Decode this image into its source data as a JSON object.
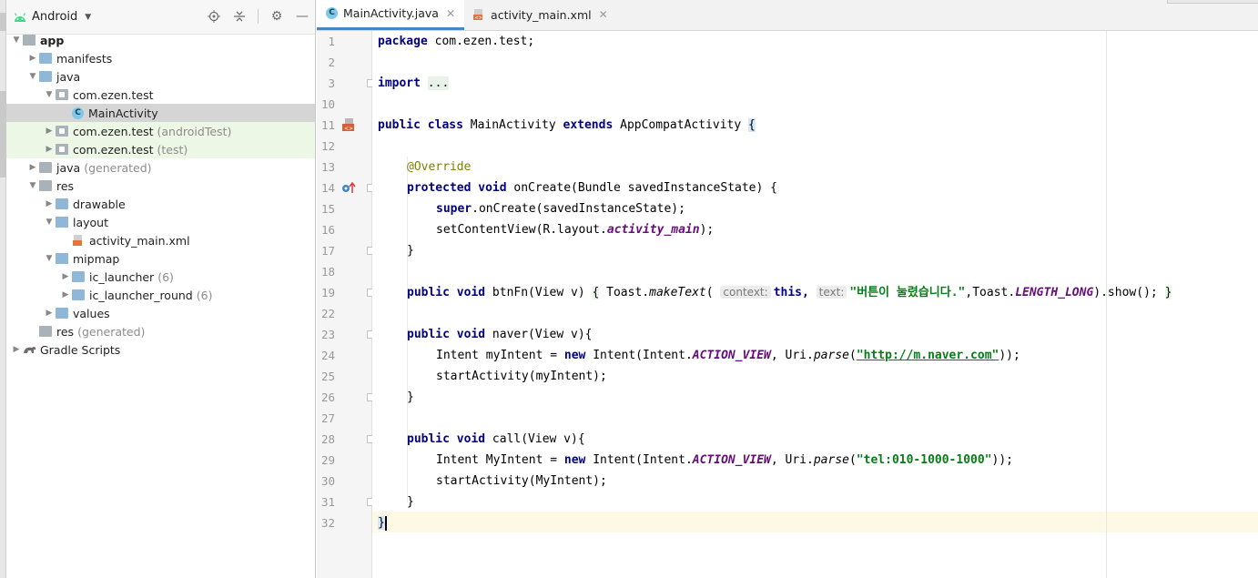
{
  "project_panel": {
    "view_mode": "Android",
    "tree": [
      {
        "label": "app",
        "depth": 0,
        "expanded": true,
        "icon": "module-icon",
        "bold": true
      },
      {
        "label": "manifests",
        "depth": 1,
        "expanded": false,
        "icon": "folder-icon"
      },
      {
        "label": "java",
        "depth": 1,
        "expanded": true,
        "icon": "folder-icon"
      },
      {
        "label": "com.ezen.test",
        "depth": 2,
        "expanded": true,
        "icon": "package-icon"
      },
      {
        "label": "MainActivity",
        "depth": 3,
        "icon": "java-class-icon",
        "selected": true
      },
      {
        "label": "com.ezen.test",
        "suffix": "(androidTest)",
        "depth": 2,
        "expanded": false,
        "icon": "package-icon",
        "test": true
      },
      {
        "label": "com.ezen.test",
        "suffix": "(test)",
        "depth": 2,
        "expanded": false,
        "icon": "package-icon",
        "test": true
      },
      {
        "label": "java",
        "suffix": "(generated)",
        "depth": 1,
        "expanded": false,
        "icon": "generated-folder-icon"
      },
      {
        "label": "res",
        "depth": 1,
        "expanded": true,
        "icon": "res-folder-icon"
      },
      {
        "label": "drawable",
        "depth": 2,
        "expanded": false,
        "icon": "folder-icon"
      },
      {
        "label": "layout",
        "depth": 2,
        "expanded": true,
        "icon": "folder-icon"
      },
      {
        "label": "activity_main.xml",
        "depth": 3,
        "icon": "xml-file-icon"
      },
      {
        "label": "mipmap",
        "depth": 2,
        "expanded": true,
        "icon": "folder-icon"
      },
      {
        "label": "ic_launcher",
        "suffix": "(6)",
        "depth": 3,
        "expanded": false,
        "icon": "folder-icon"
      },
      {
        "label": "ic_launcher_round",
        "suffix": "(6)",
        "depth": 3,
        "expanded": false,
        "icon": "folder-icon"
      },
      {
        "label": "values",
        "depth": 2,
        "expanded": false,
        "icon": "folder-icon"
      },
      {
        "label": "res",
        "suffix": "(generated)",
        "depth": 1,
        "icon": "res-folder-icon"
      },
      {
        "label": "Gradle Scripts",
        "depth": 0,
        "expanded": false,
        "icon": "gradle-icon"
      }
    ]
  },
  "tabs": [
    {
      "label": "MainActivity.java",
      "icon": "java-class-icon",
      "active": true
    },
    {
      "label": "activity_main.xml",
      "icon": "xml-file-icon",
      "active": false
    }
  ],
  "editor": {
    "current_line": "32",
    "lines": [
      {
        "n": "1"
      },
      {
        "n": "2"
      },
      {
        "n": "3"
      },
      {
        "n": "10"
      },
      {
        "n": "11"
      },
      {
        "n": "12"
      },
      {
        "n": "13"
      },
      {
        "n": "14"
      },
      {
        "n": "15"
      },
      {
        "n": "16"
      },
      {
        "n": "17"
      },
      {
        "n": "18"
      },
      {
        "n": "19"
      },
      {
        "n": "22"
      },
      {
        "n": "23"
      },
      {
        "n": "24"
      },
      {
        "n": "25"
      },
      {
        "n": "26"
      },
      {
        "n": "27"
      },
      {
        "n": "28"
      },
      {
        "n": "29"
      },
      {
        "n": "30"
      },
      {
        "n": "31"
      },
      {
        "n": "32"
      }
    ],
    "code": {
      "package_kw": "package",
      "package_name": " com.ezen.test;",
      "import_kw": "import",
      "import_fold": "...",
      "class_decl_kw": "public class",
      "class_name": " MainActivity ",
      "extends_kw": "extends",
      "superclass": " AppCompatActivity ",
      "open_brace": "{",
      "override": "@Override",
      "oncreate_mods": "protected void",
      "oncreate_sig": " onCreate(Bundle savedInstanceState) {",
      "super_kw": "super",
      "super_call": ".onCreate(savedInstanceState);",
      "set_content": "setContentView(R.layout.",
      "layout_field": "activity_main",
      "set_content_end": ");",
      "close_brace": "}",
      "btn_mods": "public void",
      "btn_sig": " btnFn(View v) ",
      "btn_lambda_open": "{",
      "toast_call": " Toast.",
      "make_text": "makeText",
      "paren_open": "(",
      "hint_context": "context:",
      "this_kw": "this",
      "comma": ",",
      "hint_text": "text:",
      "toast_msg": "\"버튼이 눌렸습니다.\"",
      "toast_class": ",Toast.",
      "length_long": "LENGTH_LONG",
      "show_call": ").show(); ",
      "btn_lambda_close": "}",
      "naver_mods": "public void",
      "naver_sig": " naver(View v){",
      "intent_decl1": "Intent myIntent = ",
      "new_kw": "new",
      "intent_ctor": " Intent(Intent.",
      "action_view": "ACTION_VIEW",
      "uri_part": ", Uri.",
      "parse": "parse",
      "naver_url": "\"http://m.naver.com\"",
      "call_end": "));",
      "start_activity1": "startActivity(myIntent);",
      "call_mods": "public void",
      "call_sig": " call(View v){",
      "intent_decl2": "Intent MyIntent = ",
      "tel_str": "\"tel:010-1000-1000\"",
      "start_activity2": "startActivity(MyIntent);"
    }
  },
  "colors": {
    "keyword": "#000080",
    "string": "#067d17",
    "annotation": "#808000",
    "static_field": "#660e7a",
    "current_line_bg": "#fdf9e5",
    "active_tab_underline": "#4a86c7"
  }
}
